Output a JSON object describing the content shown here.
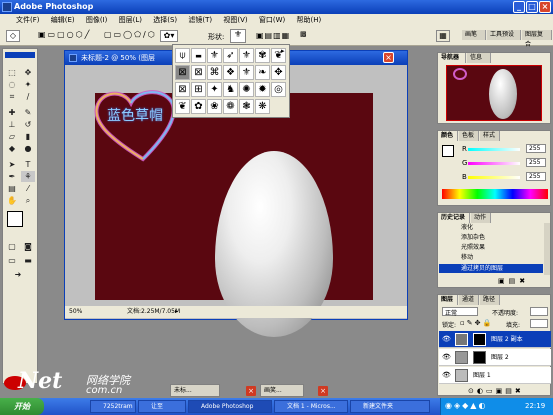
{
  "app": {
    "title": "Adobe Photoshop"
  },
  "menu": [
    "文件(F)",
    "编辑(E)",
    "图像(I)",
    "图层(L)",
    "选择(S)",
    "滤镜(T)",
    "视图(V)",
    "窗口(W)",
    "帮助(H)"
  ],
  "options": {
    "shape_label": "形状:"
  },
  "document": {
    "title": "未标题-2 @ 50% (图层",
    "zoom": "50%",
    "doc_size": "文档:2.25M/7.05M",
    "heart_text": "蓝色草帽"
  },
  "panels": {
    "navigator": {
      "tabs": [
        "导航器",
        "信息"
      ]
    },
    "color": {
      "tabs": [
        "颜色",
        "色板",
        "样式"
      ],
      "r_label": "R",
      "g_label": "G",
      "b_label": "B",
      "r": "255",
      "g": "255",
      "b": "255"
    },
    "history": {
      "tabs": [
        "历史记录",
        "动作"
      ],
      "items": [
        "添加杂色",
        "光照效果",
        "移动",
        "通过拷贝的图层"
      ],
      "partial_top": "液化"
    },
    "layers": {
      "tabs": [
        "图层",
        "通道",
        "路径"
      ],
      "blend_mode": "正常",
      "opacity_label": "不透明度:",
      "lock_label": "锁定:",
      "fill_label": "填充:",
      "items": [
        "图层 2 副本",
        "图层 2",
        "图层 1"
      ]
    }
  },
  "top_tabs": [
    "画笔",
    "工具预设",
    "图层复合"
  ],
  "watermark": {
    "brand": "Net",
    "chinese": "网络学院",
    "domain": "com.cn"
  },
  "minimized": [
    "未标...",
    "画笑..."
  ],
  "taskbar": {
    "start": "开始",
    "tasks": [
      "7252tram",
      "让至",
      "Adobe Photoshop",
      "文档 1 - Micros...",
      "新建文件夹"
    ],
    "clock": "22:19"
  }
}
